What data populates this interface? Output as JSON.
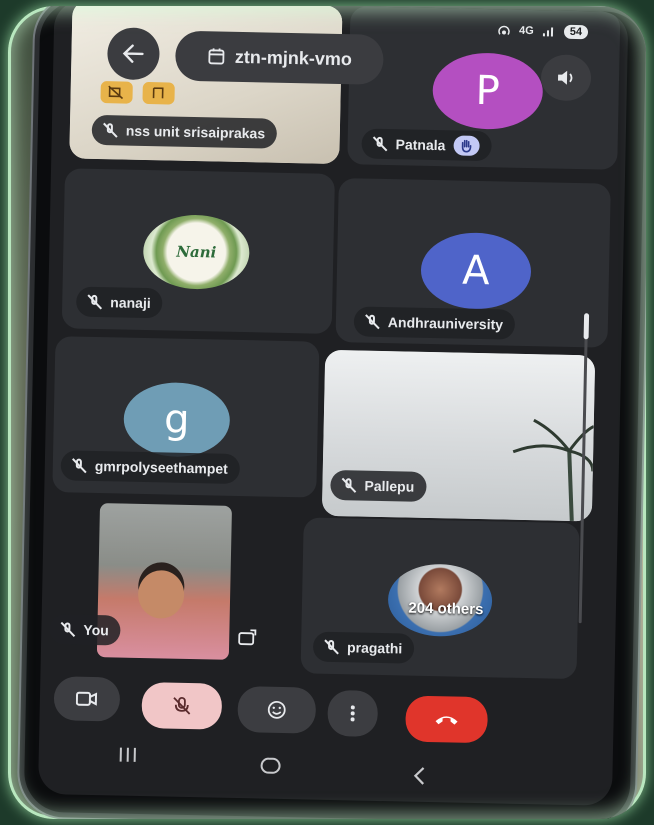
{
  "status": {
    "time": "",
    "network": "4G",
    "battery": "54"
  },
  "header": {
    "meeting_code": "ztn-mjnk-vmo"
  },
  "participants": [
    {
      "name": "nss unit srisaiprakas",
      "avatar_letter": "",
      "avatar_color": ""
    },
    {
      "name": "Patnala",
      "avatar_letter": "P",
      "avatar_color": "#b44fc1"
    },
    {
      "name": "nanaji",
      "avatar_letter": "",
      "avatar_color": "",
      "avatar_text": "Nani"
    },
    {
      "name": "Andhrauniversity",
      "avatar_letter": "A",
      "avatar_color": "#4f64c9"
    },
    {
      "name": "gmrpolyseethampet",
      "avatar_letter": "g",
      "avatar_color": "#6f9db5"
    },
    {
      "name": "Pallepu",
      "avatar_letter": "",
      "avatar_color": ""
    },
    {
      "name": "You",
      "avatar_letter": "",
      "avatar_color": ""
    },
    {
      "name": "pragathi",
      "avatar_letter": "",
      "avatar_color": ""
    }
  ],
  "others_count_label": "204 others",
  "controls": {
    "end_call_color": "#e0352b",
    "mic_color": "#f1c6c7"
  },
  "colors": {
    "tile": "#2d2f33",
    "screen_bg": "#1f2023"
  }
}
